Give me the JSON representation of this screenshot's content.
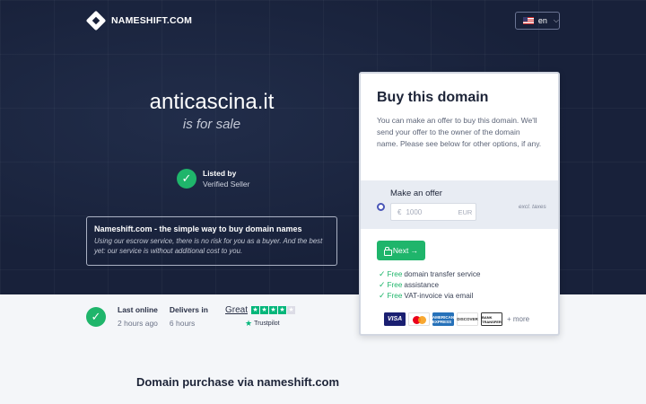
{
  "header": {
    "brand": "NAMESHIFT.COM",
    "language": {
      "code": "en",
      "flag": "us-flag-icon"
    }
  },
  "hero": {
    "domain": "anticascina.it",
    "tagline": "is for sale",
    "listed": {
      "title": "Listed by",
      "subtitle": "Verified Seller"
    },
    "info": {
      "title": "Nameshift.com - the simple way to buy domain names",
      "text": "Using our escrow service, there is no risk for you as a buyer. And the best yet: our service is without additional cost to you."
    }
  },
  "stats": {
    "last_online_label": "Last online",
    "last_online_value": "2 hours ago",
    "delivers_label": "Delivers in",
    "delivers_value": "6 hours"
  },
  "trustpilot": {
    "rating_word": "Great",
    "brand": "Trustpilot",
    "stars": 4,
    "max_stars": 5
  },
  "card": {
    "title": "Buy this domain",
    "description": "You can make an offer to buy this domain. We'll send your offer to the owner of the domain name. Please see below for other options, if any.",
    "offer": {
      "label": "Make an offer",
      "currency_symbol": "€",
      "amount_placeholder": "1000",
      "currency": "EUR",
      "tax_note": "excl. taxes"
    },
    "next_label": "Next →",
    "features": [
      {
        "free": "Free",
        "text": "domain transfer service"
      },
      {
        "free": "Free",
        "text": "assistance"
      },
      {
        "free": "Free",
        "text": "VAT-invoice via email"
      }
    ],
    "payment": {
      "visa": "VISA",
      "amex": "AMERICAN EXPRESS",
      "discover": "DISCOVER",
      "bank": "BANK TRANSFER",
      "more": "+ more"
    }
  },
  "section": {
    "title": "Domain purchase via nameshift.com"
  },
  "colors": {
    "accent_green": "#1fb56b",
    "hero_bg": "#18213a",
    "radio": "#4a56b7"
  }
}
